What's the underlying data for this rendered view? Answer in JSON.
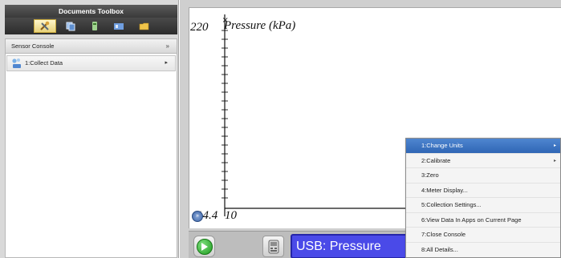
{
  "toolbox": {
    "title": "Documents Toolbox",
    "tabs": [
      {
        "icon": "tools-icon",
        "active": true
      },
      {
        "icon": "page-sorter-icon",
        "active": false
      },
      {
        "icon": "variables-icon",
        "active": false
      },
      {
        "icon": "library-icon",
        "active": false
      },
      {
        "icon": "folder-icon",
        "active": false
      }
    ],
    "panel": {
      "header": "Sensor Console",
      "collapse_glyph": "»",
      "items": [
        {
          "label": "1:Collect Data",
          "icon": "sensor-icon",
          "arrow": "▸"
        }
      ]
    }
  },
  "graph": {
    "y_label": "Pressure (kPa)",
    "y_max": "220",
    "x_min": "14.4",
    "x_min_2": "10"
  },
  "console": {
    "meter_text": "USB: Pressure"
  },
  "context_menu": {
    "items": [
      {
        "label": "1:Change Units",
        "active": true,
        "submenu": true
      },
      {
        "label": "2:Calibrate",
        "active": false,
        "submenu": true
      },
      {
        "label": "3:Zero",
        "active": false,
        "submenu": false
      },
      {
        "label": "4:Meter Display...",
        "active": false,
        "submenu": false
      },
      {
        "label": "5:Collection Settings...",
        "active": false,
        "submenu": false
      },
      {
        "label": "6:View Data In Apps on Current Page",
        "active": false,
        "submenu": false
      },
      {
        "label": "7:Close Console",
        "active": false,
        "submenu": false
      },
      {
        "label": "8:All Details...",
        "active": false,
        "submenu": false
      }
    ],
    "submenu_glyph": "▸"
  },
  "colors": {
    "menu_highlight": "#3a72c0",
    "meter_background": "#4a4ae8",
    "play_green": "#1d9a1d"
  }
}
